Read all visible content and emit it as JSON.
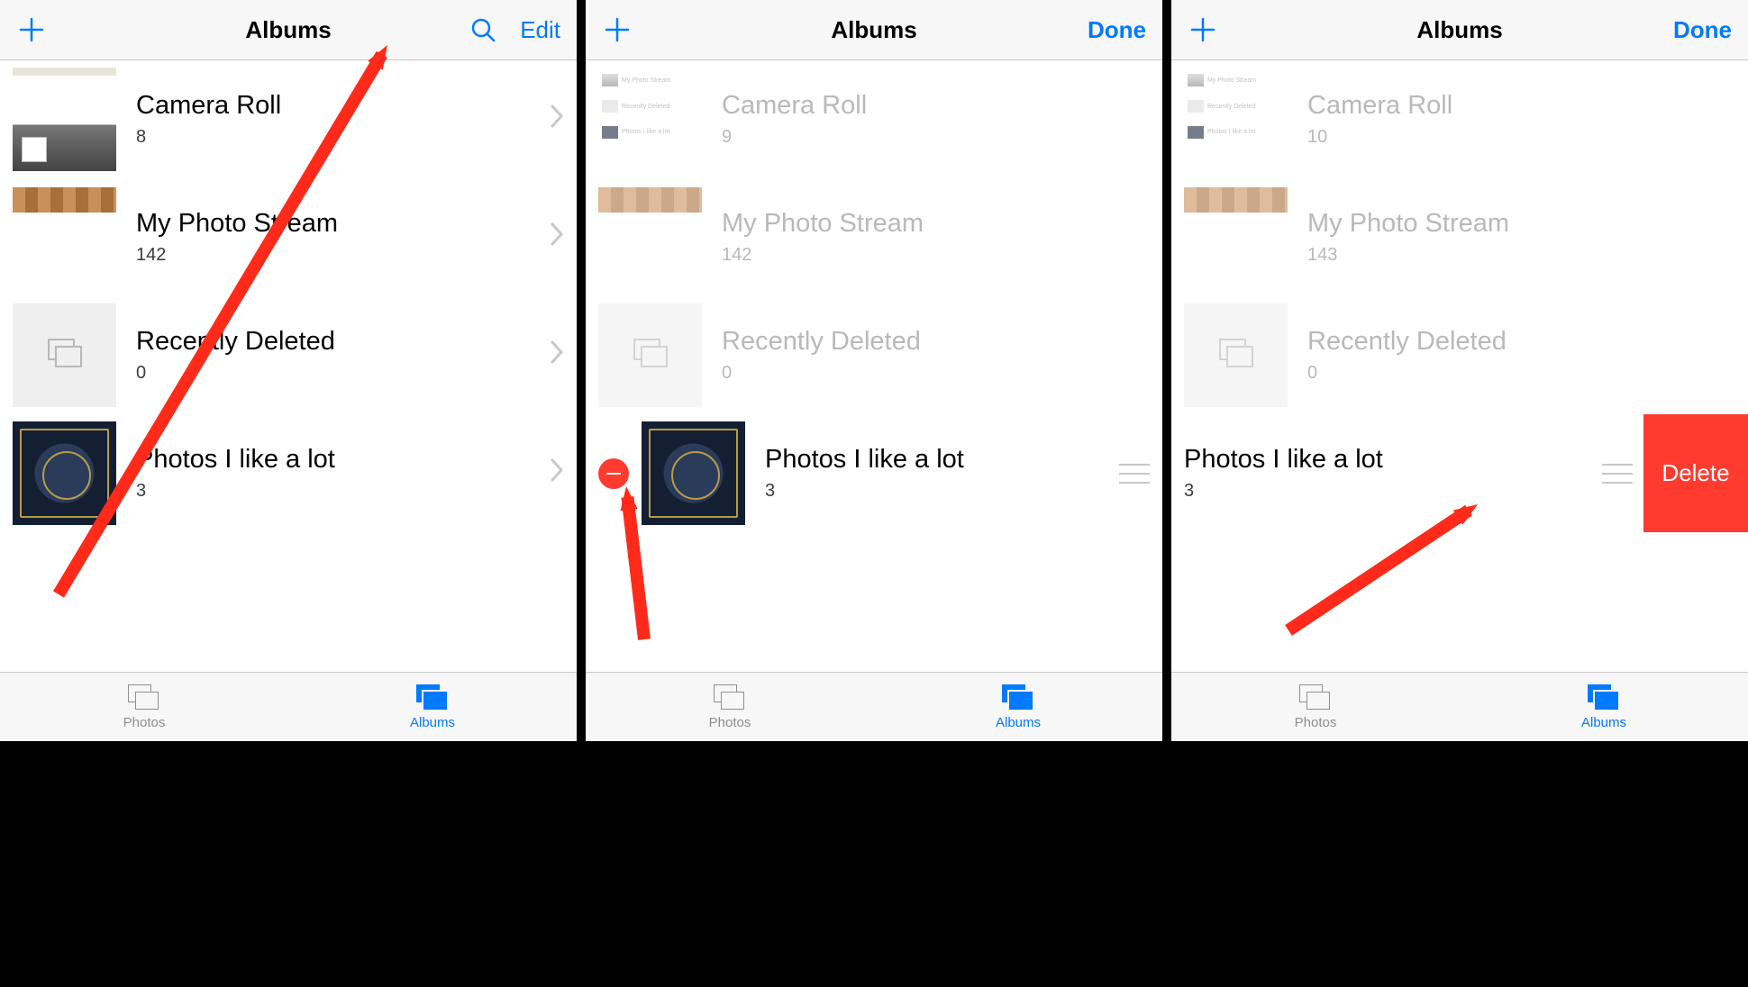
{
  "header": {
    "title": "Albums",
    "edit_label": "Edit",
    "done_label": "Done"
  },
  "panels": [
    {
      "right_button": "edit",
      "show_search": true,
      "albums": [
        {
          "title": "Camera Roll",
          "count": "8",
          "thumb": "cameraroll-a",
          "mode": "chevron",
          "dimmed": false
        },
        {
          "title": "My Photo Stream",
          "count": "142",
          "thumb": "stream",
          "mode": "chevron",
          "dimmed": false
        },
        {
          "title": "Recently Deleted",
          "count": "0",
          "thumb": "placeholder",
          "mode": "chevron",
          "dimmed": false
        },
        {
          "title": "Photos I like a lot",
          "count": "3",
          "thumb": "book",
          "mode": "chevron",
          "dimmed": false
        }
      ]
    },
    {
      "right_button": "done",
      "show_search": false,
      "albums": [
        {
          "title": "Camera Roll",
          "count": "9",
          "thumb": "cameraroll-b",
          "mode": "none",
          "dimmed": true
        },
        {
          "title": "My Photo Stream",
          "count": "142",
          "thumb": "stream",
          "mode": "none",
          "dimmed": true
        },
        {
          "title": "Recently Deleted",
          "count": "0",
          "thumb": "placeholder",
          "mode": "none",
          "dimmed": true
        },
        {
          "title": "Photos I like a lot",
          "count": "3",
          "thumb": "book",
          "mode": "edit-handle",
          "dimmed": false
        }
      ]
    },
    {
      "right_button": "done",
      "show_search": false,
      "albums": [
        {
          "title": "Camera Roll",
          "count": "10",
          "thumb": "cameraroll-c",
          "mode": "none",
          "dimmed": true
        },
        {
          "title": "My Photo Stream",
          "count": "143",
          "thumb": "stream",
          "mode": "none",
          "dimmed": true
        },
        {
          "title": "Recently Deleted",
          "count": "0",
          "thumb": "placeholder",
          "mode": "none",
          "dimmed": true
        },
        {
          "title": "Photos I like a lot",
          "count": "3",
          "thumb": "book-dim",
          "mode": "delete-btn",
          "dimmed": false
        }
      ]
    }
  ],
  "delete_label": "Delete",
  "tabs": {
    "photos": "Photos",
    "albums": "Albums"
  },
  "colors": {
    "accent": "#007aff",
    "destructive": "#ff3b30",
    "annotation": "#ff2a1a"
  }
}
